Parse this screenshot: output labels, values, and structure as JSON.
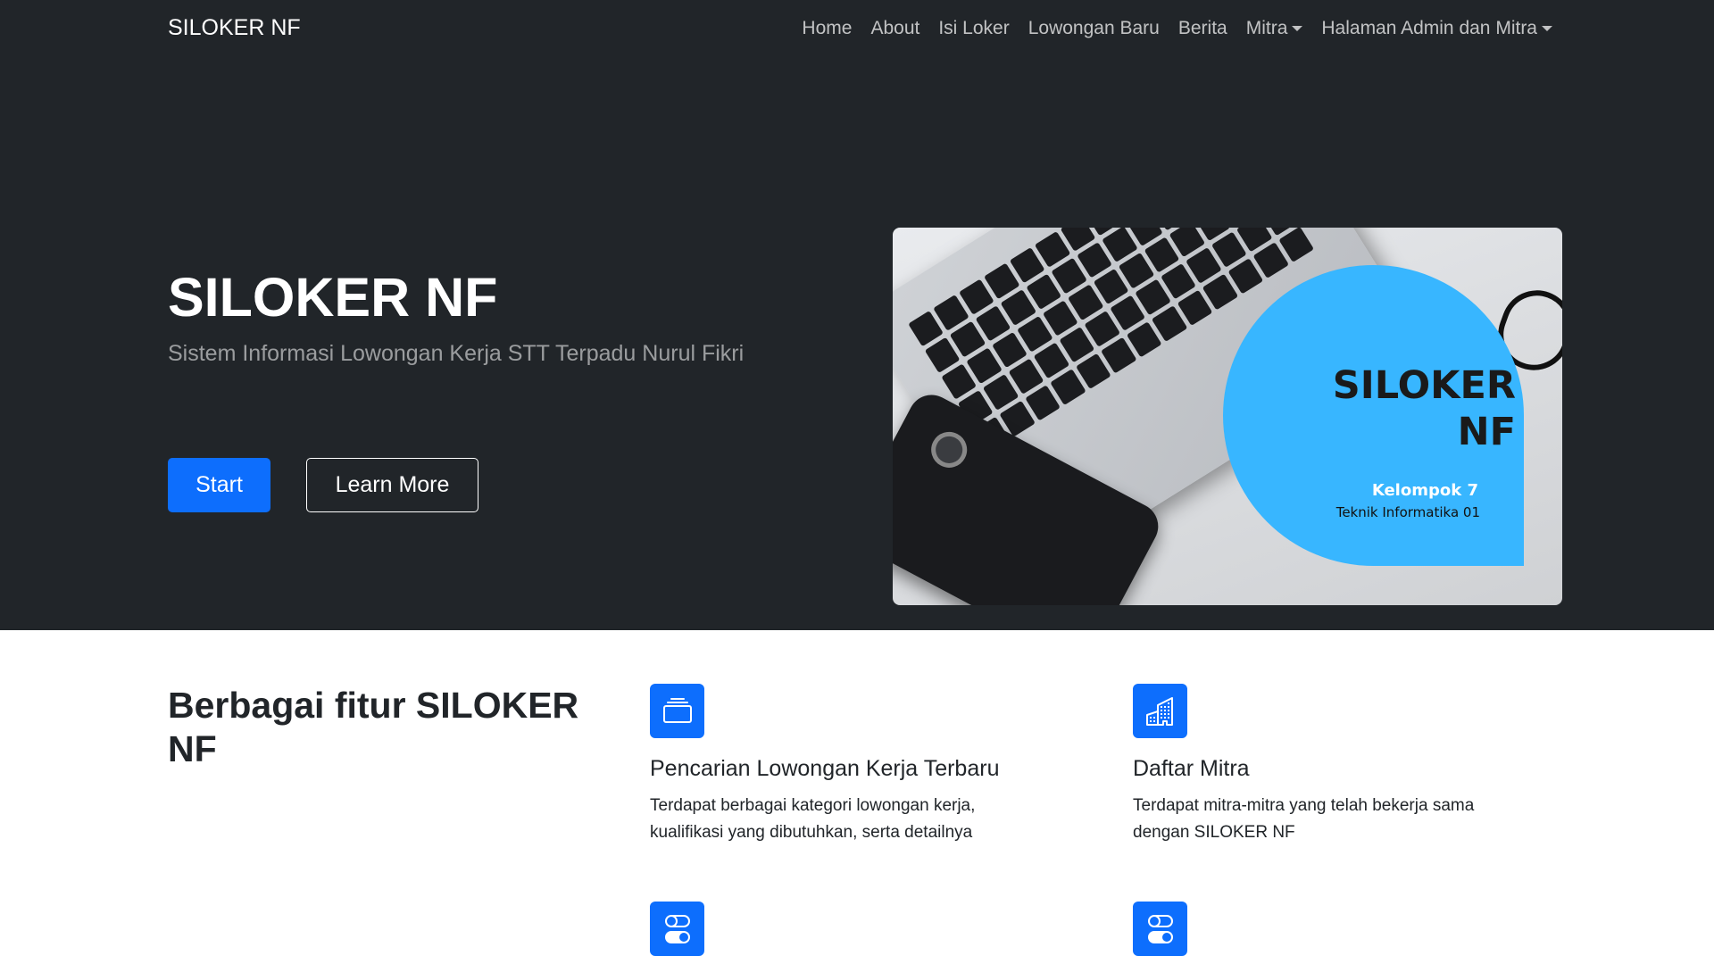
{
  "navbar": {
    "brand": "SILOKER NF",
    "links": [
      {
        "label": "Home"
      },
      {
        "label": "About"
      },
      {
        "label": "Isi Loker"
      },
      {
        "label": "Lowongan Baru"
      },
      {
        "label": "Berita"
      },
      {
        "label": "Mitra",
        "dropdown": true
      },
      {
        "label": "Halaman Admin dan Mitra",
        "dropdown": true
      }
    ]
  },
  "hero": {
    "title": "SILOKER NF",
    "subtitle": "Sistem Informasi Lowongan Kerja STT Terpadu Nurul Fikri",
    "start_label": "Start",
    "learn_label": "Learn More",
    "image": {
      "title": "SILOKER NF",
      "group": "Kelompok 7",
      "subtitle": "Teknik Informatika 01",
      "accent_color": "#38b6ff"
    }
  },
  "features": {
    "title": "Berbagai fitur SILOKER NF",
    "items": [
      {
        "icon": "collection-icon",
        "title": "Pencarian Lowongan Kerja Terbaru",
        "description": "Terdapat berbagai kategori lowongan kerja, kualifikasi yang dibutuhkan, serta detailnya"
      },
      {
        "icon": "building-icon",
        "title": "Daftar Mitra",
        "description": "Terdapat mitra-mitra yang telah bekerja sama dengan SILOKER NF"
      },
      {
        "icon": "toggles-icon",
        "title": "",
        "description": ""
      },
      {
        "icon": "toggles-icon",
        "title": "",
        "description": ""
      }
    ]
  },
  "colors": {
    "dark_bg": "#212529",
    "primary": "#0d6efd",
    "accent": "#38b6ff"
  }
}
